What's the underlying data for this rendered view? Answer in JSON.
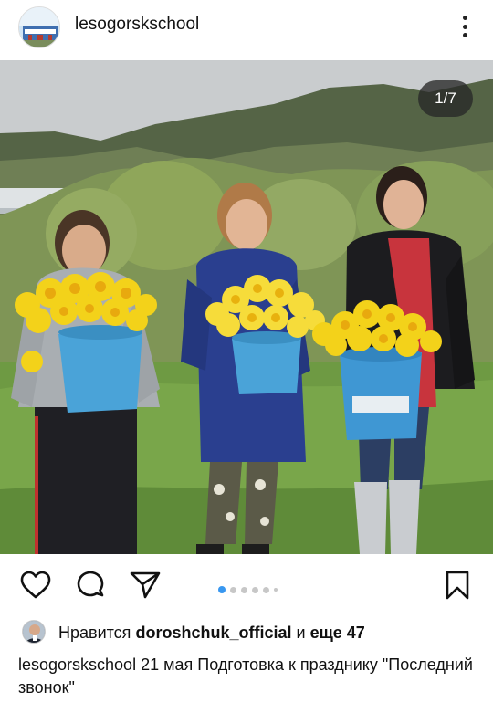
{
  "post": {
    "username": "lesogorskschool",
    "image_counter": "1/7",
    "carousel": {
      "total_dots": 6,
      "active_index": 0
    }
  },
  "likes": {
    "prefix": "Нравится",
    "liker": "doroshchuk_official",
    "conjunction": "и",
    "others": "еще 47"
  },
  "caption": {
    "username": "lesogorskschool",
    "text": "21 мая Подготовка к празднику \"Последний звонок\""
  },
  "icons": {
    "like": "heart-icon",
    "comment": "comment-icon",
    "share": "send-icon",
    "save": "bookmark-icon",
    "more": "more-vertical-icon"
  },
  "colors": {
    "accent": "#3897f0"
  }
}
